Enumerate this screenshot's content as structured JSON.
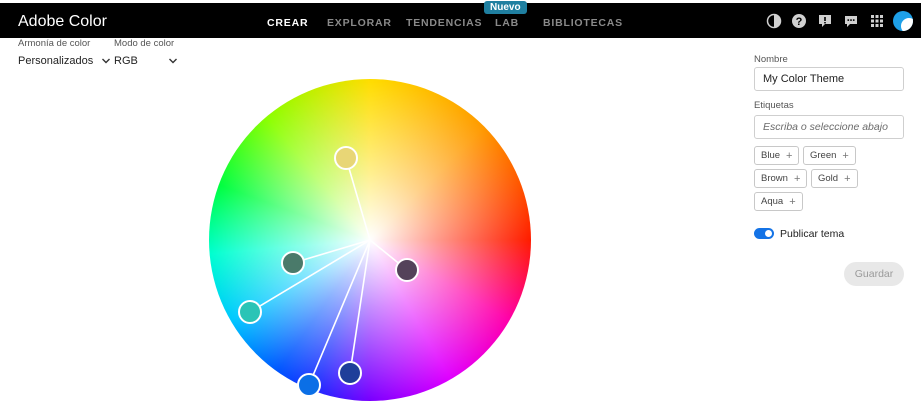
{
  "header": {
    "brand": "Adobe Color",
    "nav": [
      "CREAR",
      "EXPLORAR",
      "TENDENCIAS",
      "LAB",
      "BIBLIOTECAS"
    ],
    "active_nav": "CREAR",
    "badge": "Nuevo",
    "icons": [
      "theme-toggle-icon",
      "help-icon",
      "feedback-icon",
      "chat-icon",
      "apps-grid-icon",
      "avatar"
    ]
  },
  "controls": {
    "harmony_label": "Armonía de color",
    "harmony_value": "Personalizados",
    "mode_label": "Modo de color",
    "mode_value": "RGB"
  },
  "wheel": {
    "swatches": [
      {
        "color": "#e8d676",
        "name": "swatch-1"
      },
      {
        "color": "#4a7a6a",
        "name": "swatch-2"
      },
      {
        "color": "#2ac4b6",
        "name": "swatch-3"
      },
      {
        "color": "#0b6fe6",
        "name": "swatch-4"
      },
      {
        "color": "#1f3f9a",
        "name": "swatch-5"
      },
      {
        "color": "#54425a",
        "name": "swatch-6"
      }
    ]
  },
  "sidebar": {
    "name_label": "Nombre",
    "name_value": "My Color Theme",
    "tags_label": "Etiquetas",
    "tags_placeholder": "Escriba o seleccione abajo",
    "tags": [
      "Blue",
      "Green",
      "Brown",
      "Gold",
      "Aqua"
    ],
    "publish_label": "Publicar tema",
    "publish_enabled": true,
    "save_label": "Guardar"
  }
}
